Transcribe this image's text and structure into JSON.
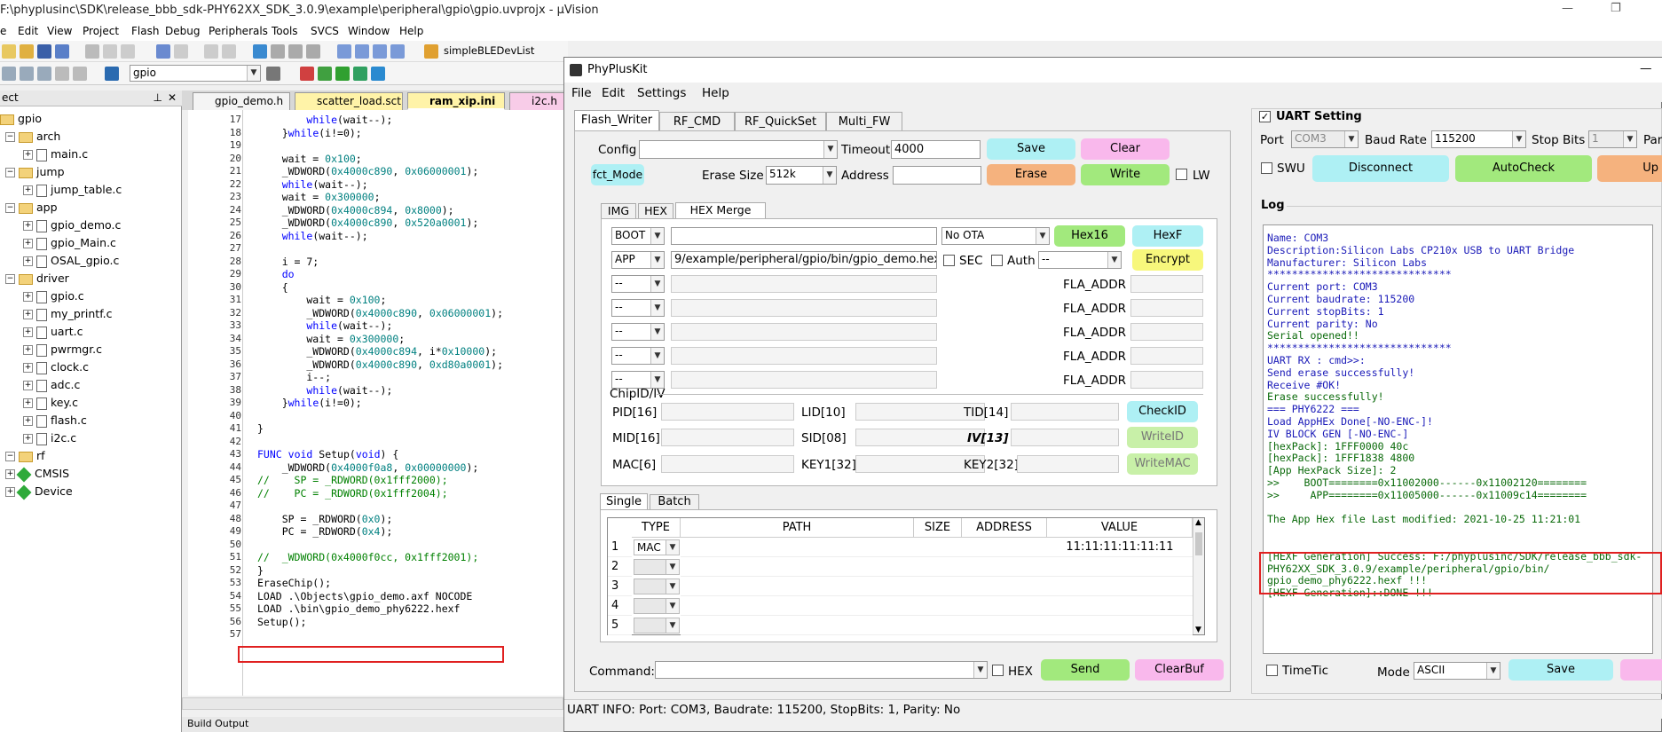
{
  "uvision": {
    "title": "F:\\phyplusinc\\SDK\\release_bbb_sdk-PHY62XX_SDK_3.0.9\\example\\peripheral\\gpio\\gpio.uvprojx - µVision",
    "menu": [
      "e",
      "Edit",
      "View",
      "Project",
      "Flash",
      "Debug",
      "Peripherals",
      "Tools",
      "SVCS",
      "Window",
      "Help"
    ],
    "toolbar_combo": "simpleBLEDevList",
    "target_combo": "gpio",
    "project_header": "ect",
    "tree": [
      {
        "label": "gpio",
        "kind": "root"
      },
      {
        "label": "arch",
        "kind": "folder"
      },
      {
        "label": "main.c",
        "kind": "file"
      },
      {
        "label": "jump",
        "kind": "folder"
      },
      {
        "label": "jump_table.c",
        "kind": "file"
      },
      {
        "label": "app",
        "kind": "folder"
      },
      {
        "label": "gpio_demo.c",
        "kind": "file"
      },
      {
        "label": "gpio_Main.c",
        "kind": "file"
      },
      {
        "label": "OSAL_gpio.c",
        "kind": "file"
      },
      {
        "label": "driver",
        "kind": "folder"
      },
      {
        "label": "gpio.c",
        "kind": "file"
      },
      {
        "label": "my_printf.c",
        "kind": "file"
      },
      {
        "label": "uart.c",
        "kind": "file"
      },
      {
        "label": "pwrmgr.c",
        "kind": "file"
      },
      {
        "label": "clock.c",
        "kind": "file"
      },
      {
        "label": "adc.c",
        "kind": "file"
      },
      {
        "label": "key.c",
        "kind": "file"
      },
      {
        "label": "flash.c",
        "kind": "file"
      },
      {
        "label": "i2c.c",
        "kind": "file"
      },
      {
        "label": "rf",
        "kind": "folder"
      },
      {
        "label": "CMSIS",
        "kind": "comp"
      },
      {
        "label": "Device",
        "kind": "comp"
      }
    ],
    "tabs": [
      "gpio_demo.h",
      "scatter_load.sct",
      "ram_xip.ini",
      "i2c.h"
    ],
    "code_lines": [
      {
        "n": "17",
        "t": "        while(wait--);"
      },
      {
        "n": "18",
        "t": "    }while(i!=0);"
      },
      {
        "n": "19",
        "t": ""
      },
      {
        "n": "20",
        "t": "    wait = 0x100;"
      },
      {
        "n": "21",
        "t": "    _WDWORD(0x4000c890, 0x06000001);"
      },
      {
        "n": "22",
        "t": "    while(wait--);"
      },
      {
        "n": "23",
        "t": "    wait = 0x300000;"
      },
      {
        "n": "24",
        "t": "    _WDWORD(0x4000c894, 0x8000);"
      },
      {
        "n": "25",
        "t": "    _WDWORD(0x4000c890, 0x520a0001);"
      },
      {
        "n": "26",
        "t": "    while(wait--);"
      },
      {
        "n": "27",
        "t": ""
      },
      {
        "n": "28",
        "t": "    i = 7;"
      },
      {
        "n": "29",
        "t": "    do"
      },
      {
        "n": "30",
        "t": "    {"
      },
      {
        "n": "31",
        "t": "        wait = 0x100;"
      },
      {
        "n": "32",
        "t": "        _WDWORD(0x4000c890, 0x06000001);"
      },
      {
        "n": "33",
        "t": "        while(wait--);"
      },
      {
        "n": "34",
        "t": "        wait = 0x300000;"
      },
      {
        "n": "35",
        "t": "        _WDWORD(0x4000c894, i*0x10000);"
      },
      {
        "n": "36",
        "t": "        _WDWORD(0x4000c890, 0xd80a0001);"
      },
      {
        "n": "37",
        "t": "        i--;"
      },
      {
        "n": "38",
        "t": "        while(wait--);"
      },
      {
        "n": "39",
        "t": "    }while(i!=0);"
      },
      {
        "n": "40",
        "t": ""
      },
      {
        "n": "41",
        "t": "}"
      },
      {
        "n": "42",
        "t": ""
      },
      {
        "n": "43",
        "t": "FUNC void Setup(void) {"
      },
      {
        "n": "44",
        "t": "    _WDWORD(0x4000f0a8, 0x00000000);"
      },
      {
        "n": "45",
        "t": "//    SP = _RDWORD(0x1fff2000);"
      },
      {
        "n": "46",
        "t": "//    PC = _RDWORD(0x1fff2004);"
      },
      {
        "n": "47",
        "t": ""
      },
      {
        "n": "48",
        "t": "    SP = _RDWORD(0x0);"
      },
      {
        "n": "49",
        "t": "    PC = _RDWORD(0x4);"
      },
      {
        "n": "50",
        "t": ""
      },
      {
        "n": "51",
        "t": "//  _WDWORD(0x4000f0cc, 0x1fff2001);"
      },
      {
        "n": "52",
        "t": "}"
      },
      {
        "n": "53",
        "t": "EraseChip();"
      },
      {
        "n": "54",
        "t": "LOAD .\\Objects\\gpio_demo.axf NOCODE"
      },
      {
        "n": "55",
        "t": "LOAD .\\bin\\gpio_demo_phy6222.hexf"
      },
      {
        "n": "56",
        "t": "Setup();"
      },
      {
        "n": "57",
        "t": ""
      }
    ],
    "bottom_label": "Build Output"
  },
  "ppk": {
    "title": "PhyPlusKit",
    "menu": [
      "File",
      "Edit",
      "Settings",
      "Help"
    ],
    "tabs": [
      "Flash_Writer",
      "RF_CMD",
      "RF_QuickSet",
      "Multi_FW"
    ],
    "config_label": "Config",
    "config_value": "",
    "timeout_label": "Timeout",
    "timeout_value": "4000",
    "save": "Save",
    "clear": "Clear",
    "fct_mode": "fct_Mode",
    "erase_size_label": "Erase Size",
    "erase_size": "512k",
    "address_label": "Address",
    "address_value": "",
    "erase": "Erase",
    "write": "Write",
    "lw": "LW",
    "subtabs": [
      "IMG",
      "HEX",
      "HEX Merge"
    ],
    "boot": "BOOT",
    "boot_path": "",
    "ota": "No OTA",
    "hex16": "Hex16",
    "hexf": "HexF",
    "app": "APP",
    "app_path": "9/example/peripheral/gpio/bin/gpio_demo.hex",
    "sec": "SEC",
    "auth": "Auth",
    "auth_sel": "--",
    "encrypt": "Encrypt",
    "dash": "--",
    "fla_addr": "FLA_ADDR",
    "chipid_label": "ChipID/IV",
    "pid": "PID[16]",
    "lid": "LID[10]",
    "tid": "TID[14]",
    "checkid": "CheckID",
    "mid": "MID[16]",
    "sid": "SID[08]",
    "iv": "IV[13]",
    "writeid": "WriteID",
    "mac": "MAC[6]",
    "key1": "KEY1[32]",
    "key2": "KEY2[32]",
    "writemac": "WriteMAC",
    "bottom_tabs": [
      "Single",
      "Batch"
    ],
    "table_headers": [
      "TYPE",
      "PATH",
      "SIZE",
      "ADDRESS",
      "VALUE"
    ],
    "table_rows": [
      {
        "n": "1",
        "type": "MAC",
        "value": "11:11:11:11:11:11"
      },
      {
        "n": "2",
        "type": "",
        "value": ""
      },
      {
        "n": "3",
        "type": "",
        "value": ""
      },
      {
        "n": "4",
        "type": "",
        "value": ""
      },
      {
        "n": "5",
        "type": "",
        "value": ""
      }
    ],
    "command_label": "Command:",
    "hex": "HEX",
    "send": "Send",
    "clearbuf": "ClearBuf",
    "uart_setting": "UART Setting",
    "port_label": "Port",
    "port": "COM3",
    "baud_label": "Baud Rate",
    "baud": "115200",
    "stopbits_label": "Stop Bits",
    "stopbits": "1",
    "parity_label": "Par",
    "swu": "SWU",
    "disconnect": "Disconnect",
    "autocheck": "AutoCheck",
    "up": "Up",
    "log_label": "Log",
    "log_lines": [
      {
        "t": "Name: COM3",
        "c": "b"
      },
      {
        "t": "Description:Silicon Labs CP210x USB to UART Bridge",
        "c": "b"
      },
      {
        "t": "Manufacturer: Silicon Labs",
        "c": "b"
      },
      {
        "t": "******************************",
        "c": "b"
      },
      {
        "t": "Current port: COM3",
        "c": "b"
      },
      {
        "t": "Current baudrate: 115200",
        "c": "b"
      },
      {
        "t": "Current stopBits: 1",
        "c": "b"
      },
      {
        "t": "Current parity: No",
        "c": "b"
      },
      {
        "t": "Serial opened!!",
        "c": "g"
      },
      {
        "t": "******************************",
        "c": "b"
      },
      {
        "t": "UART RX : cmd>>:",
        "c": "b"
      },
      {
        "t": "Send erase successfully!",
        "c": "b"
      },
      {
        "t": "Receive #OK!",
        "c": "b"
      },
      {
        "t": "Erase successfully!",
        "c": "g"
      },
      {
        "t": "=== PHY6222 ===",
        "c": "b"
      },
      {
        "t": "Load AppHEx Done[-NO-ENC-]!",
        "c": "b"
      },
      {
        "t": "IV BLOCK GEN [-NO-ENC-]",
        "c": "b"
      },
      {
        "t": "[hexPack]: 1FFF0000 40c",
        "c": "g"
      },
      {
        "t": "[hexPack]: 1FFF1838 4800",
        "c": "g"
      },
      {
        "t": "[App HexPack Size]: 2",
        "c": "g"
      },
      {
        "t": ">>    BOOT========0x11002000------0x11002120========",
        "c": "g"
      },
      {
        "t": ">>     APP========0x11005000------0x11009c14========",
        "c": "g"
      },
      {
        "t": "",
        "c": "g"
      },
      {
        "t": "The App Hex file Last modified: 2021-10-25 11:21:01",
        "c": "g"
      },
      {
        "t": "",
        "c": "g"
      },
      {
        "t": "",
        "c": "g"
      },
      {
        "t": "[HEXF Generation] Success: F:/phyplusinc/SDK/release_bbb_sdk-",
        "c": "g"
      },
      {
        "t": "PHY62XX_SDK_3.0.9/example/peripheral/gpio/bin/",
        "c": "g"
      },
      {
        "t": "gpio_demo_phy6222.hexf !!!",
        "c": "g"
      },
      {
        "t": "[HEXF Generation]::DONE !!!",
        "c": "g"
      }
    ],
    "timetic": "TimeTic",
    "mode_label": "Mode",
    "mode": "ASCII",
    "save2": "Save",
    "status": "UART INFO:  Port: COM3, Baudrate: 115200, StopBits: 1, Parity: No"
  }
}
